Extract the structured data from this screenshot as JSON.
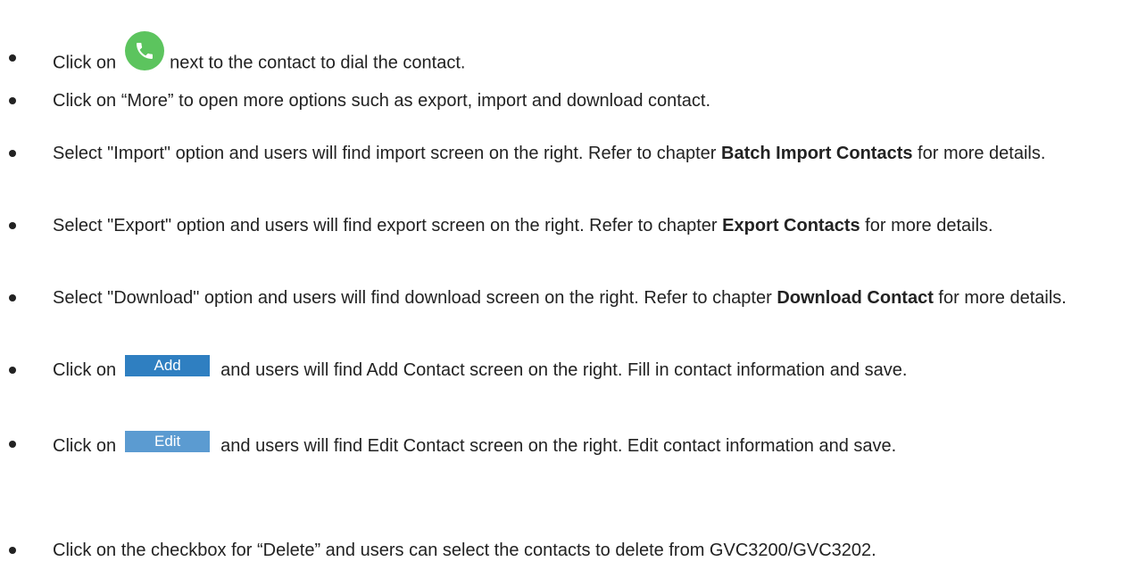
{
  "items": [
    {
      "before": "Click on",
      "icon": "phone-call-icon",
      "after": "next to the contact to dial the contact."
    },
    {
      "text": "Click on “More” to open more options such as export, import and download contact."
    },
    {
      "text": "Select \"Import\" option and users will find import screen on the right. Refer to chapter ",
      "bold": "Batch Import Contacts",
      "after": " for more details."
    },
    {
      "text": "Select \"Export\" option and users will find export screen on the right. Refer to chapter ",
      "bold": "Export Contacts",
      "after": " for more details."
    },
    {
      "text": "Select \"Download\" option and users will find download screen on the right. Refer to chapter ",
      "bold": "Download Contact",
      "after": " for more details."
    },
    {
      "before": "Click on",
      "button": "Add",
      "after": "and users will find Add Contact screen on the right. Fill in contact information and save."
    },
    {
      "before": "Click on",
      "button": "Edit",
      "after": "and users will find Edit Contact screen on the right. Edit contact information and save."
    },
    {
      "text": "Click on the checkbox for “Delete” and users can select the contacts to delete from GVC3200/GVC3202."
    }
  ],
  "colors": {
    "phone_icon": "#5cc45e",
    "add_button": "#2f7fc1",
    "edit_button": "#5b9bd1"
  }
}
